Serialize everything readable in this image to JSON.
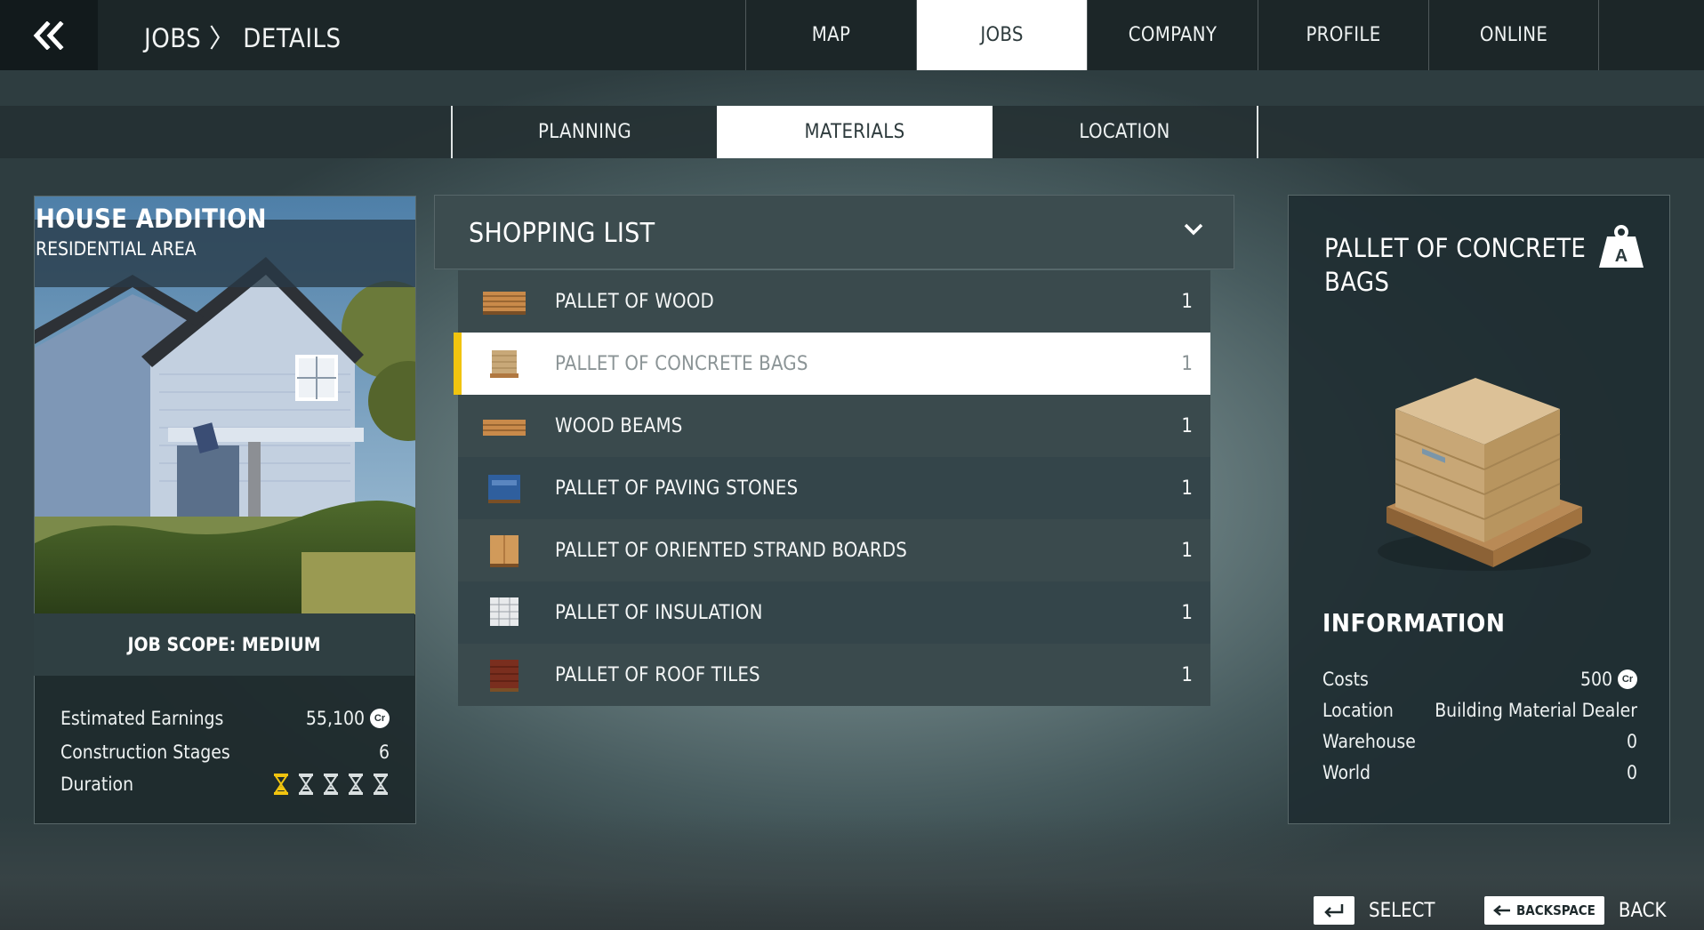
{
  "breadcrumb": "JOBS 〉 DETAILS",
  "main_tabs": [
    {
      "label": "MAP"
    },
    {
      "label": "JOBS"
    },
    {
      "label": "COMPANY"
    },
    {
      "label": "PROFILE"
    },
    {
      "label": "ONLINE"
    }
  ],
  "active_main_tab": "JOBS",
  "sub_tabs": [
    {
      "label": "PLANNING"
    },
    {
      "label": "MATERIALS"
    },
    {
      "label": "LOCATION"
    }
  ],
  "active_sub_tab": "MATERIALS",
  "job": {
    "title": "HOUSE ADDITION",
    "subtitle": "RESIDENTIAL AREA",
    "scope": "JOB SCOPE: MEDIUM",
    "stats": [
      {
        "label": "Estimated Earnings",
        "value": "55,100",
        "currency": "Cr"
      },
      {
        "label": "Construction Stages",
        "value": "6"
      },
      {
        "label": "Duration",
        "filled": 1,
        "total": 5
      }
    ]
  },
  "shopping_list": {
    "title": "SHOPPING LIST",
    "items": [
      {
        "name": "PALLET OF WOOD",
        "qty": "1",
        "icon": "wood-pallet-icon"
      },
      {
        "name": "PALLET OF CONCRETE BAGS",
        "qty": "1",
        "icon": "concrete-bags-icon",
        "selected": true
      },
      {
        "name": "WOOD BEAMS",
        "qty": "1",
        "icon": "wood-beams-icon"
      },
      {
        "name": "PALLET OF PAVING STONES",
        "qty": "1",
        "icon": "paving-stones-icon"
      },
      {
        "name": "PALLET OF ORIENTED STRAND BOARDS",
        "qty": "1",
        "icon": "osb-boards-icon"
      },
      {
        "name": "PALLET OF INSULATION",
        "qty": "1",
        "icon": "insulation-icon"
      },
      {
        "name": "PALLET OF ROOF TILES",
        "qty": "1",
        "icon": "roof-tiles-icon"
      }
    ]
  },
  "detail": {
    "title": "PALLET OF CONCRETE BAGS",
    "weight_class": "A",
    "info_title": "INFORMATION",
    "info": [
      {
        "label": "Costs",
        "value": "500",
        "currency": "Cr"
      },
      {
        "label": "Location",
        "value": "Building Material Dealer"
      },
      {
        "label": "Warehouse",
        "value": "0"
      },
      {
        "label": "World",
        "value": "0"
      }
    ]
  },
  "footer": {
    "select_label": "SELECT",
    "back_key": "BACKSPACE",
    "back_label": "BACK"
  },
  "colors": {
    "accent": "#f1c40f",
    "panel": "#3a4a4d",
    "topbar": "#1c2628"
  }
}
